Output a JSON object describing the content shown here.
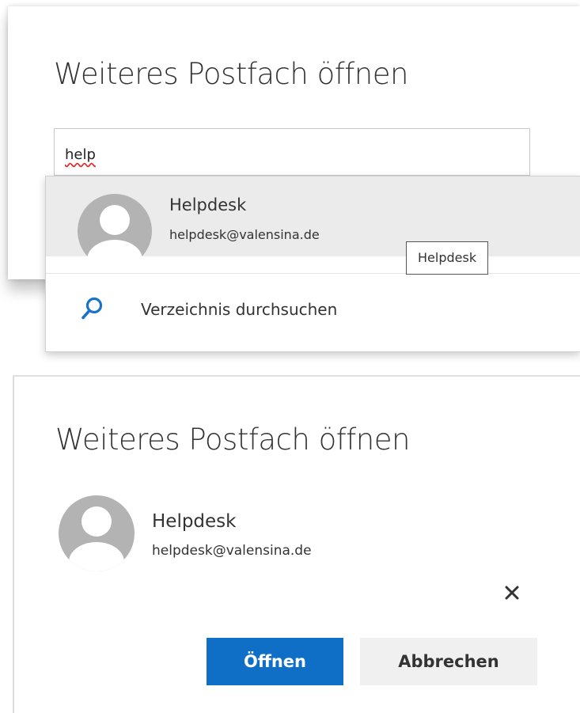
{
  "search_panel": {
    "title": "Weiteres Postfach öffnen",
    "search": {
      "value": "help"
    },
    "suggestion": {
      "name": "Helpdesk",
      "email": "helpdesk@valensina.de",
      "avatar_icon": "person-avatar-icon"
    },
    "directory_search": {
      "label": "Verzeichnis durchsuchen",
      "icon": "search-icon"
    },
    "tooltip": "Helpdesk"
  },
  "selected_panel": {
    "title": "Weiteres Postfach öffnen",
    "person": {
      "name": "Helpdesk",
      "email": "helpdesk@valensina.de",
      "avatar_icon": "person-avatar-icon"
    },
    "remove_icon": "close-icon",
    "buttons": {
      "open_label": "Öffnen",
      "cancel_label": "Abbrechen"
    }
  },
  "colors": {
    "primary_button": "#0f6fc6",
    "secondary_button": "#f0f0f0",
    "search_icon": "#1a73c8",
    "avatar": "#b3b3b3",
    "highlight_row": "#ebebeb"
  }
}
